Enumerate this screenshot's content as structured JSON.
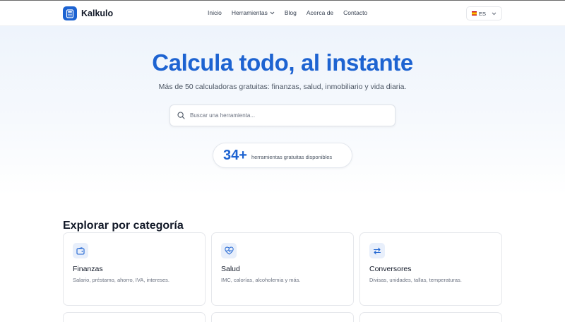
{
  "brand": {
    "name": "Kalkulo"
  },
  "nav": {
    "items": [
      {
        "label": "Inicio"
      },
      {
        "label": "Herramientas"
      },
      {
        "label": "Blog"
      },
      {
        "label": "Acerca de"
      },
      {
        "label": "Contacto"
      }
    ]
  },
  "language": {
    "current": "ES"
  },
  "hero": {
    "title": "Calcula todo, al instante",
    "subtitle": "Más de 50 calculadoras gratuitas: finanzas, salud, inmobiliario y vida diaria.",
    "search_placeholder": "Buscar una herramienta...",
    "search_value": ""
  },
  "stat": {
    "number": "34+",
    "label": "herramientas gratuitas disponibles"
  },
  "categories": {
    "title": "Explorar por categoría",
    "items": [
      {
        "icon": "wallet-icon",
        "title": "Finanzas",
        "description": "Salario, préstamo, ahorro, IVA, intereses."
      },
      {
        "icon": "heart-pulse-icon",
        "title": "Salud",
        "description": "IMC, calorías, alcoholemia y más."
      },
      {
        "icon": "arrows-exchange-icon",
        "title": "Conversores",
        "description": "Divisas, unidades, tallas, temperaturas."
      }
    ]
  },
  "colors": {
    "accent": "#1d63d1",
    "icon_bg": "#e8effb",
    "hero_bg": "#eef4fc"
  }
}
